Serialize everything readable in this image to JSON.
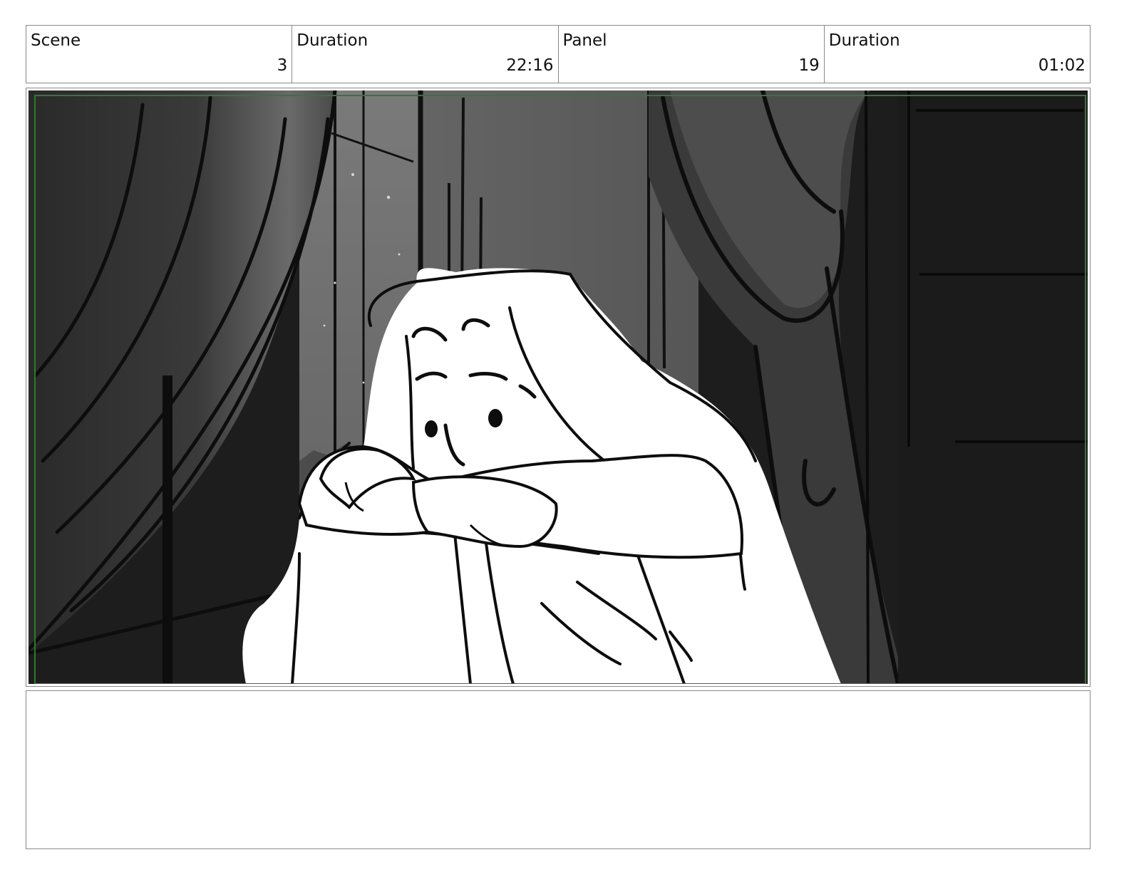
{
  "header": {
    "scene_label": "Scene",
    "scene_value": "3",
    "scene_duration_label": "Duration",
    "scene_duration_value": "22:16",
    "panel_label": "Panel",
    "panel_value": "19",
    "panel_duration_label": "Duration",
    "panel_duration_value": "01:02"
  },
  "notes": {
    "text": ""
  },
  "colors": {
    "border": "#8a8a8a",
    "safe_guide": "#2f7a2f"
  }
}
